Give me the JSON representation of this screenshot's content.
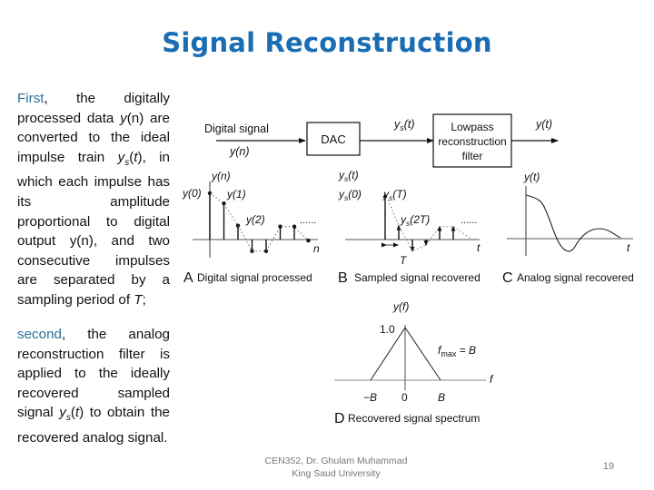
{
  "slide": {
    "title": "Signal Reconstruction",
    "paragraph1": {
      "keyword": "First",
      "segments": [
        {
          "t": "First",
          "style": "keyword"
        },
        {
          "t": ", the digitally processed data ",
          "style": "normal"
        },
        {
          "t": "y",
          "style": "italic"
        },
        {
          "t": "(n) are converted to the ideal impulse train ",
          "style": "normal"
        },
        {
          "t": "y",
          "style": "italic"
        },
        {
          "t": "s",
          "style": "italic-sub"
        },
        {
          "t": "(",
          "style": "normal"
        },
        {
          "t": "t",
          "style": "italic"
        },
        {
          "t": "), in which each impulse has its amplitude proportional to digital output y(n), and two consecutive impulses are separated by a sampling period of ",
          "style": "normal"
        },
        {
          "t": "T",
          "style": "italic"
        },
        {
          "t": ";",
          "style": "normal"
        }
      ]
    },
    "paragraph2": {
      "keyword": "second",
      "segments": [
        {
          "t": "second",
          "style": "keyword"
        },
        {
          "t": ", the analog reconstruction filter is applied to the ideally recovered sampled signal ",
          "style": "normal"
        },
        {
          "t": "y",
          "style": "italic"
        },
        {
          "t": "s",
          "style": "italic-sub"
        },
        {
          "t": "(",
          "style": "normal"
        },
        {
          "t": "t",
          "style": "italic"
        },
        {
          "t": ") to obtain the recovered analog signal.",
          "style": "normal"
        }
      ]
    },
    "footer": {
      "line1": "CEN352, Dr. Ghulam Muhammad",
      "line2": "King Saud University"
    },
    "page_number": "19"
  },
  "diagram": {
    "block": {
      "input_label": "Digital signal",
      "input_var": "y(n)",
      "dac_label": "DAC",
      "mid_var": "ys(t)",
      "filter_label_lines": [
        "Lowpass",
        "reconstruction",
        "filter"
      ],
      "output_var": "y(t)"
    },
    "panel_a": {
      "letter": "A",
      "caption": "Digital signal processed",
      "y_axis_label": "y(n)",
      "x_axis_label": "n",
      "sample_labels": [
        "y(0)",
        "y(1)",
        "y(2)"
      ],
      "ellipsis": "......",
      "samples": [
        1.0,
        0.78,
        0.3,
        -0.25,
        -0.25,
        0.28,
        0.28,
        -0.02
      ]
    },
    "panel_b": {
      "letter": "B",
      "caption": "Sampled signal recovered",
      "y_axis_label": "ys(t)",
      "x_axis_label": "t",
      "sample_labels": [
        "ys(0)",
        "ys(T)",
        "ys(2T)"
      ],
      "period_label": "T",
      "ellipsis": "......",
      "samples": [
        1.0,
        0.3,
        -0.25,
        -0.12,
        0.28,
        0.28
      ]
    },
    "panel_c": {
      "letter": "C",
      "caption": "Analog signal recovered",
      "y_axis_label": "y(t)",
      "x_axis_label": "t"
    },
    "panel_d": {
      "letter": "D",
      "caption": "Recovered signal spectrum",
      "y_axis_label": "y(f)",
      "x_axis_label": "f",
      "peak_label": "1.0",
      "fmax_label": "fmax = B",
      "x_ticks": [
        "−B",
        "0",
        "B"
      ]
    }
  }
}
